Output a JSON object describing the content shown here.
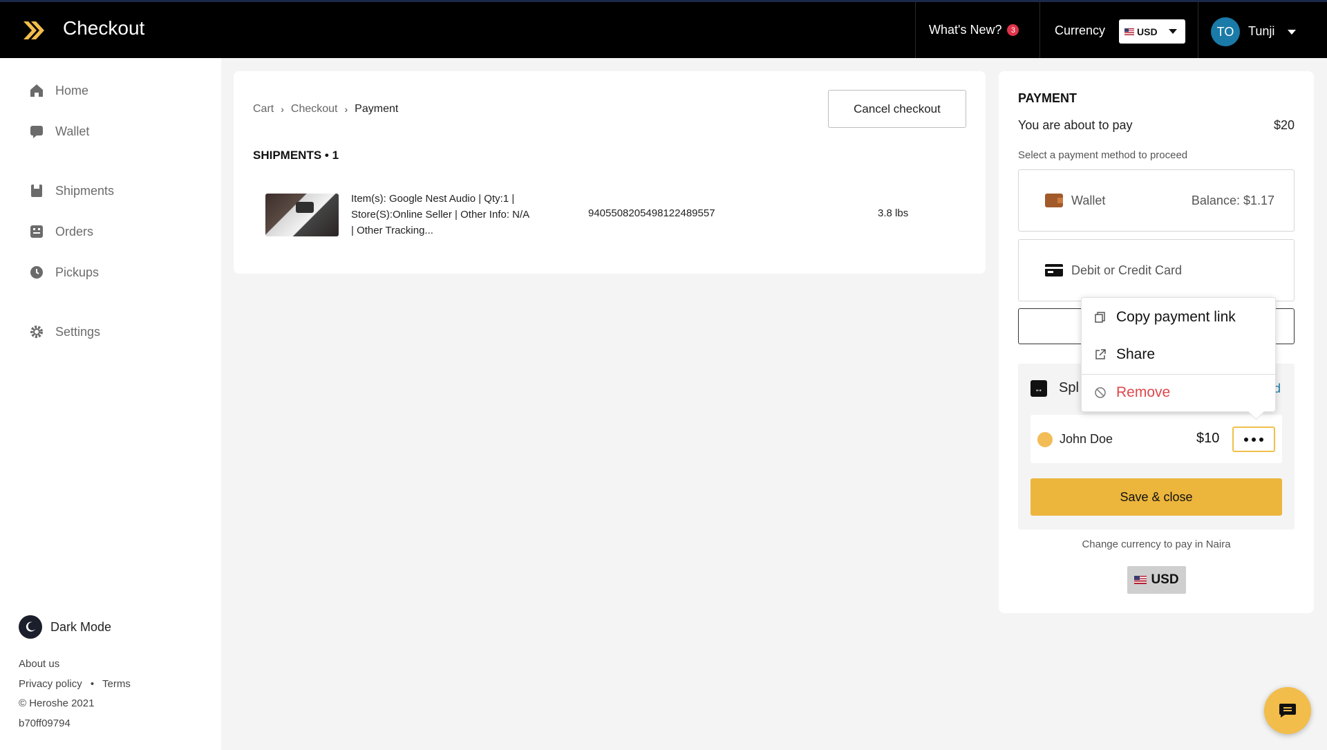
{
  "header": {
    "app_title": "Checkout",
    "whats_new_label": "What's New?",
    "whats_new_count": "3",
    "currency_label": "Currency",
    "currency_value": "USD",
    "user_initials": "TO",
    "user_name": "Tunji"
  },
  "sidebar": {
    "items": [
      {
        "label": "Home",
        "icon": "home-icon"
      },
      {
        "label": "Wallet",
        "icon": "wallet-icon"
      },
      {
        "label": "Shipments",
        "icon": "shipments-icon"
      },
      {
        "label": "Orders",
        "icon": "orders-icon"
      },
      {
        "label": "Pickups",
        "icon": "pickups-icon"
      },
      {
        "label": "Settings",
        "icon": "gear-icon"
      }
    ],
    "dark_mode_label": "Dark Mode",
    "about_label": "About us",
    "privacy_label": "Privacy policy",
    "separator": "•",
    "terms_label": "Terms",
    "copyright": "© Heroshe 2021",
    "build_id": "b70ff09794"
  },
  "main": {
    "breadcrumb": [
      "Cart",
      "Checkout",
      "Payment"
    ],
    "cancel_label": "Cancel checkout",
    "shipments_heading": "SHIPMENTS • 1",
    "shipment": {
      "description": "Item(s): Google Nest Audio | Qty:1 | Store(S):Online Seller | Other Info: N/A | Other Tracking...",
      "tracking_number": "9405508205498122489557",
      "weight": "3.8 lbs"
    }
  },
  "payment": {
    "title": "PAYMENT",
    "about_to_pay_label": "You are about to pay",
    "amount": "$20",
    "select_method_label": "Select a payment method to proceed",
    "wallet_label": "Wallet",
    "wallet_balance": "Balance: $1.17",
    "card_label": "Debit or Credit Card",
    "split_label": "Spl",
    "split_link": "d",
    "split_person": {
      "name": "John Doe",
      "amount": "$10"
    },
    "save_label": "Save & close",
    "change_currency_text": "Change currency to pay in Naira",
    "usd_label": "USD"
  },
  "popover": {
    "copy_link_label": "Copy payment link",
    "share_label": "Share",
    "remove_label": "Remove"
  },
  "colors": {
    "accent": "#ecb53c",
    "danger": "#e0464a",
    "topbar": "#000000",
    "avatar": "#1a7aa8"
  }
}
